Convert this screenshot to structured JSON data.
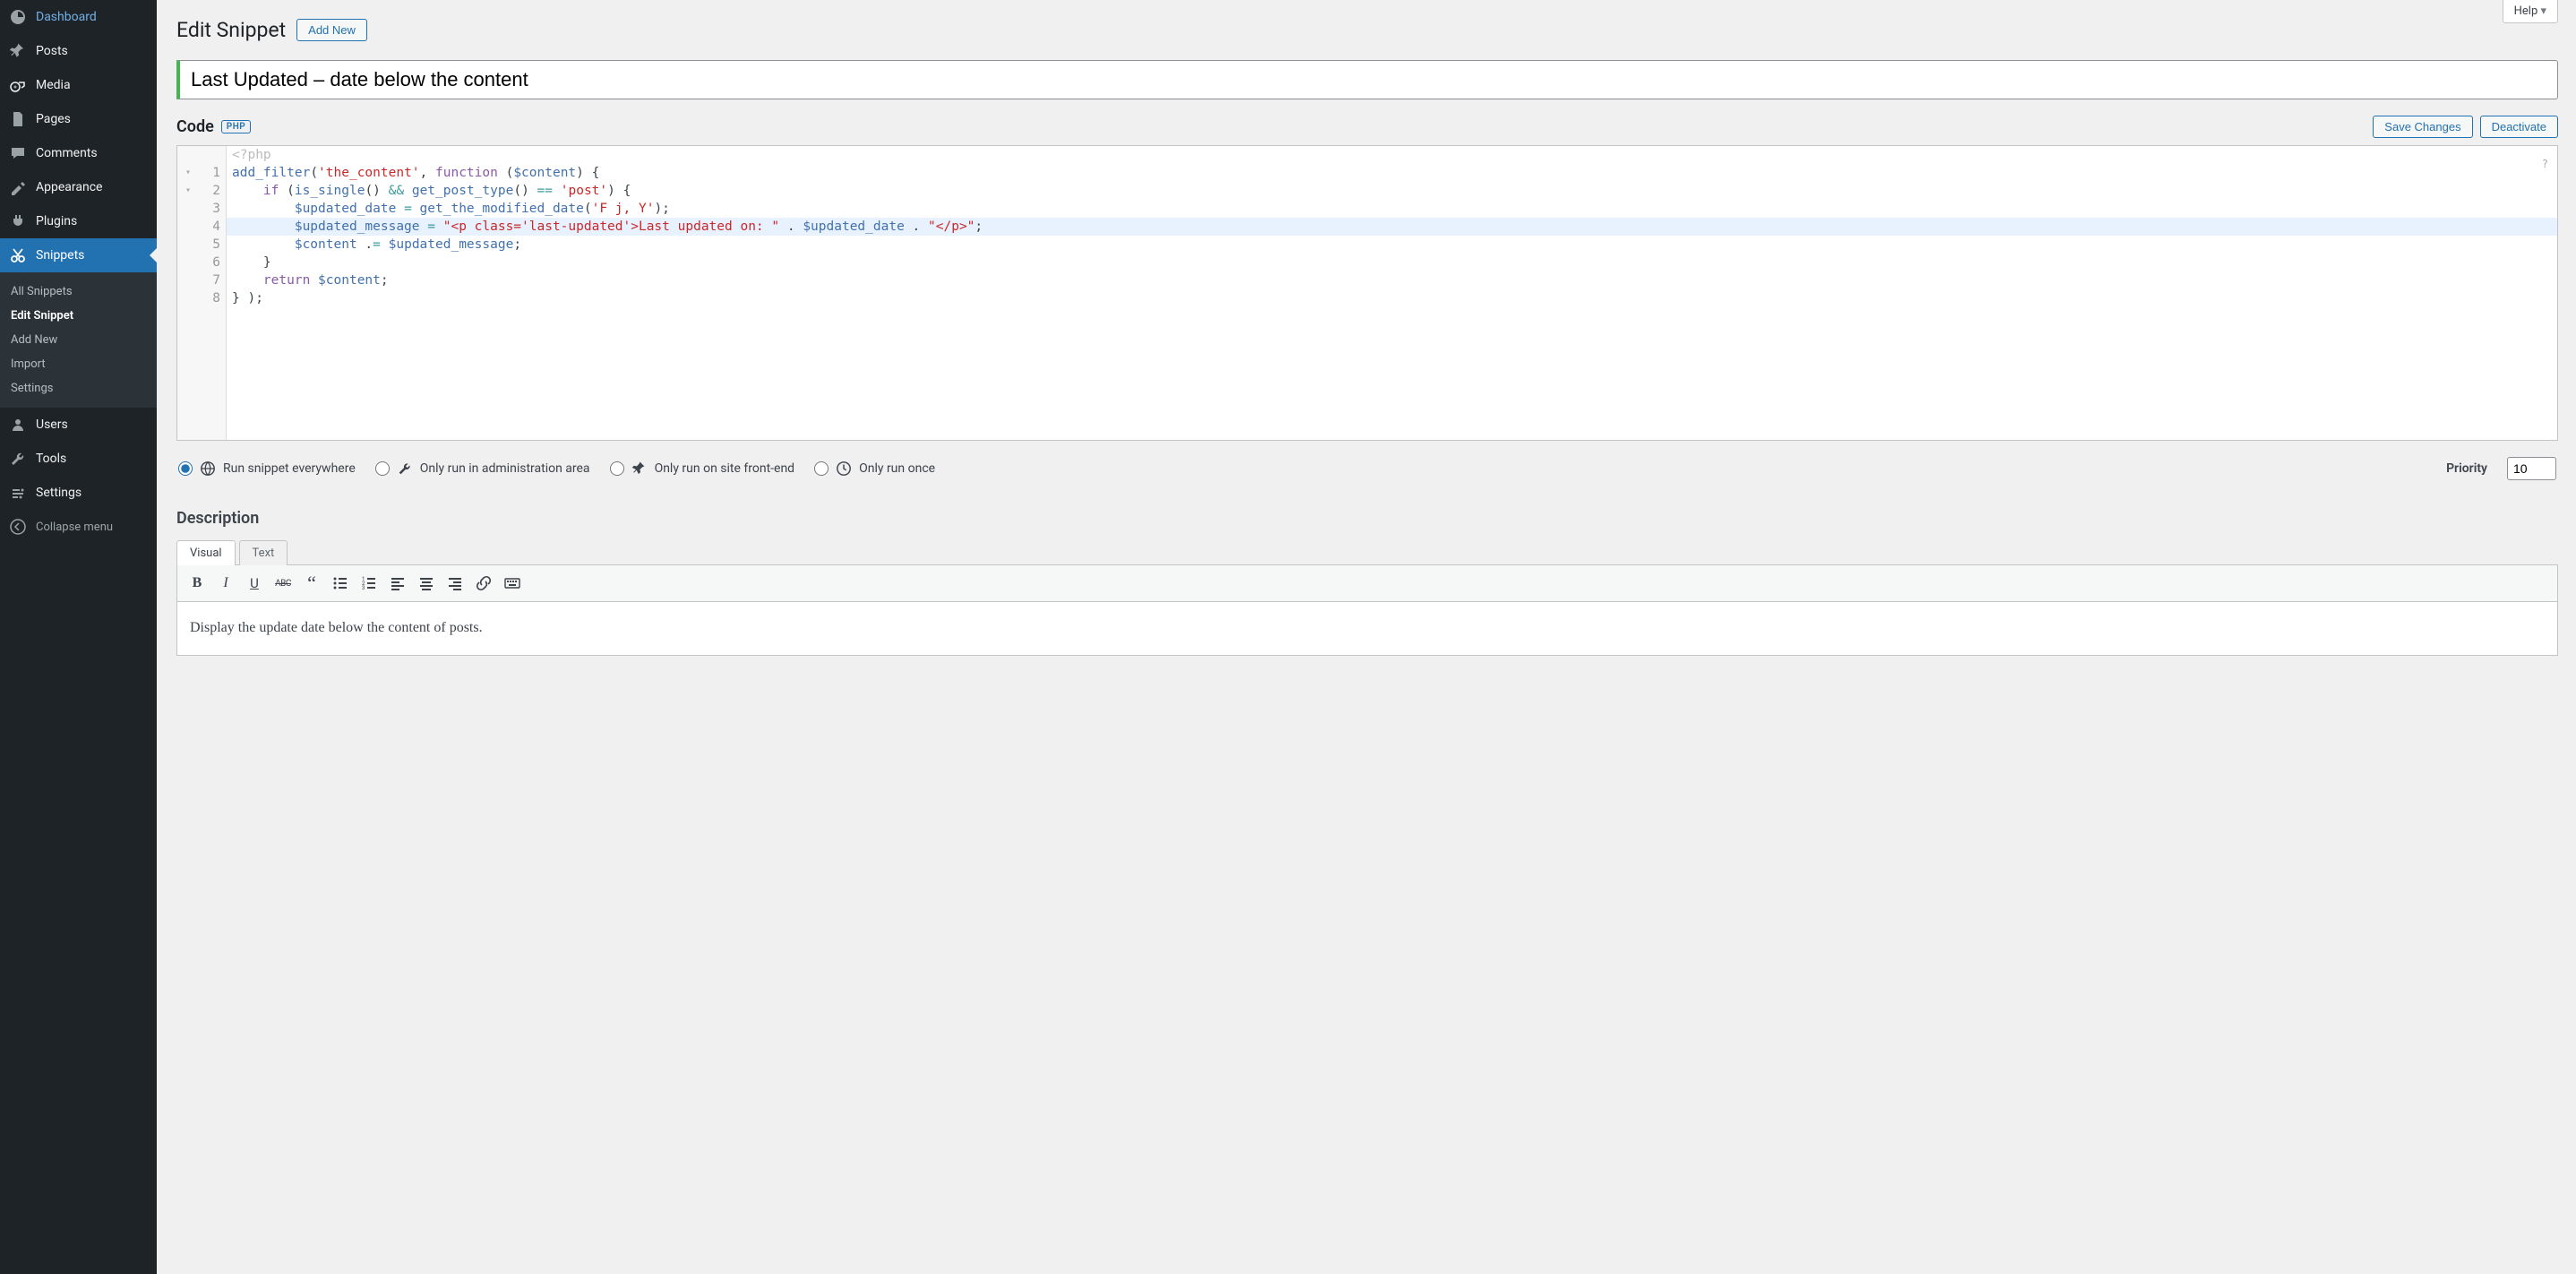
{
  "sidebar": {
    "items": [
      {
        "label": "Dashboard",
        "icon": "dashboard"
      },
      {
        "label": "Posts",
        "icon": "pin"
      },
      {
        "label": "Media",
        "icon": "media"
      },
      {
        "label": "Pages",
        "icon": "pages"
      },
      {
        "label": "Comments",
        "icon": "comments"
      },
      {
        "label": "Appearance",
        "icon": "appearance"
      },
      {
        "label": "Plugins",
        "icon": "plugins"
      },
      {
        "label": "Snippets",
        "icon": "snippets",
        "active": true
      },
      {
        "label": "Users",
        "icon": "users"
      },
      {
        "label": "Tools",
        "icon": "tools"
      },
      {
        "label": "Settings",
        "icon": "settings"
      }
    ],
    "submenu": [
      "All Snippets",
      "Edit Snippet",
      "Add New",
      "Import",
      "Settings"
    ],
    "submenu_current": "Edit Snippet",
    "collapse": "Collapse menu"
  },
  "header": {
    "help": "Help",
    "title": "Edit Snippet",
    "add_new": "Add New"
  },
  "snippet_title": "Last Updated – date below the content",
  "code_section": {
    "label": "Code",
    "badge": "PHP",
    "save": "Save Changes",
    "deactivate": "Deactivate"
  },
  "code": {
    "phptag": "<?php",
    "lines": [
      {
        "n": 1,
        "fold": "▾"
      },
      {
        "n": 2,
        "fold": "▾"
      },
      {
        "n": 3,
        "fold": ""
      },
      {
        "n": 4,
        "fold": "",
        "hl": true
      },
      {
        "n": 5,
        "fold": ""
      },
      {
        "n": 6,
        "fold": ""
      },
      {
        "n": 7,
        "fold": ""
      },
      {
        "n": 8,
        "fold": ""
      }
    ]
  },
  "scope": {
    "options": [
      {
        "label": "Run snippet everywhere",
        "checked": true
      },
      {
        "label": "Only run in administration area",
        "checked": false
      },
      {
        "label": "Only run on site front-end",
        "checked": false
      },
      {
        "label": "Only run once",
        "checked": false
      }
    ],
    "priority_label": "Priority",
    "priority_value": "10"
  },
  "description": {
    "heading": "Description",
    "tabs": {
      "visual": "Visual",
      "text": "Text"
    },
    "body": "Display the update date below the content of posts."
  }
}
